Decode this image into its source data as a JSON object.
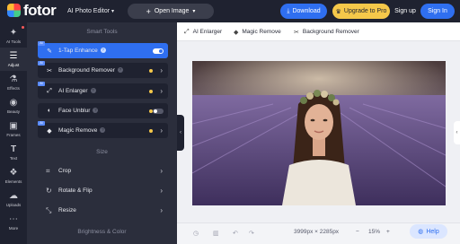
{
  "brand": {
    "logo_text": "fotor"
  },
  "header": {
    "tool_select": "AI Photo Editor",
    "open_image": "Open Image",
    "download": "Download",
    "upgrade": "Upgrade to Pro",
    "sign_up": "Sign up",
    "sign_in": "Sign In"
  },
  "rail": {
    "items": [
      {
        "label": "AI Tools",
        "icon": "sparkle-icon"
      },
      {
        "label": "Adjust",
        "icon": "sliders-icon"
      },
      {
        "label": "Effects",
        "icon": "flask-icon"
      },
      {
        "label": "Beauty",
        "icon": "eye-icon"
      },
      {
        "label": "Frames",
        "icon": "frame-icon"
      },
      {
        "label": "Text",
        "icon": "text-icon"
      },
      {
        "label": "Elements",
        "icon": "elements-icon"
      },
      {
        "label": "Uploads",
        "icon": "upload-cloud-icon"
      },
      {
        "label": "More",
        "icon": "more-icon"
      }
    ]
  },
  "panel": {
    "smart_tools_title": "Smart Tools",
    "smart_tools": [
      {
        "label": "1-Tap Enhance",
        "badge": "AI",
        "control": "toggle-on"
      },
      {
        "label": "Background Remover",
        "badge": "AI",
        "control": "chevron"
      },
      {
        "label": "AI Enlarger",
        "badge": "AI",
        "control": "chevron"
      },
      {
        "label": "Face Unblur",
        "badge": "",
        "control": "toggle-off"
      },
      {
        "label": "Magic Remove",
        "badge": "AI",
        "control": "chevron"
      }
    ],
    "size_title": "Size",
    "size_tools": [
      {
        "label": "Crop"
      },
      {
        "label": "Rotate & Flip"
      },
      {
        "label": "Resize"
      }
    ],
    "brightness_title": "Brightness & Color"
  },
  "toolbar_tabs": [
    {
      "label": "AI Enlarger"
    },
    {
      "label": "Magic Remove"
    },
    {
      "label": "Background Remover"
    }
  ],
  "canvas": {
    "dimensions": "3999px × 2285px",
    "zoom": "15%",
    "help": "Help"
  },
  "colors": {
    "dark_bg": "#1f2230",
    "panel_bg": "#2b2e3c",
    "accent_blue": "#2f6ff0",
    "upgrade_yellow": "#f5c84a"
  }
}
